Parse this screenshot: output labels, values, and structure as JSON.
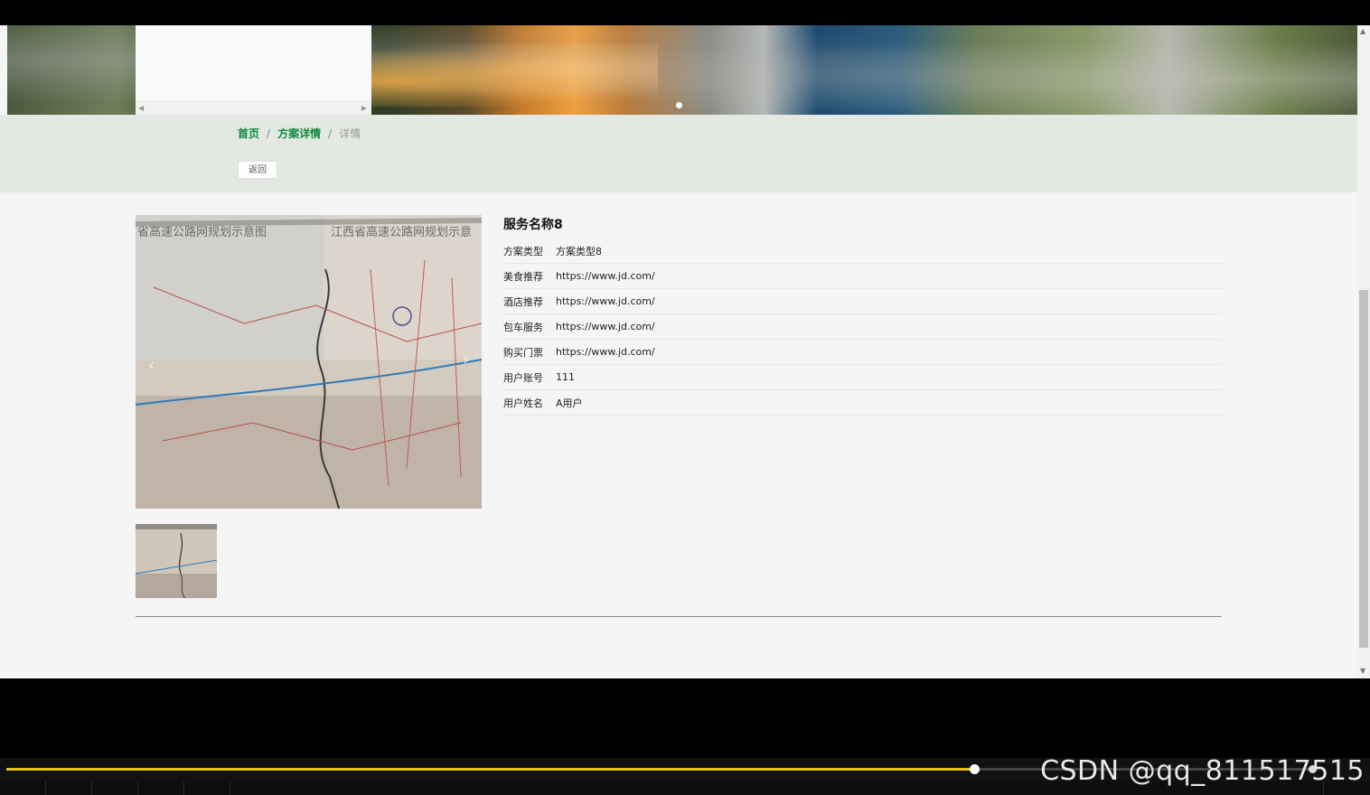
{
  "breadcrumb": {
    "home": "首页",
    "section": "方案详情",
    "current": "详情",
    "separator": "/"
  },
  "back_button": "返回",
  "service": {
    "title": "服务名称8",
    "fields": [
      {
        "label": "方案类型",
        "value": "方案类型8"
      },
      {
        "label": "美食推荐",
        "value": "https://www.jd.com/"
      },
      {
        "label": "酒店推荐",
        "value": "https://www.jd.com/"
      },
      {
        "label": "包车服务",
        "value": "https://www.jd.com/"
      },
      {
        "label": "购买门票",
        "value": "https://www.jd.com/"
      },
      {
        "label": "用户账号",
        "value": "111"
      },
      {
        "label": "用户姓名",
        "value": "A用户"
      }
    ]
  },
  "image_text": {
    "left": "省高速公路网规划示意图",
    "right": "江西省高速公路网规划示意"
  },
  "player": {
    "progress": 0.737
  },
  "watermark": "CSDN @qq_811517515",
  "colors": {
    "link": "#0a8a3a",
    "progress": "#e6c21a",
    "crumb_bg": "#e4e8e2"
  }
}
